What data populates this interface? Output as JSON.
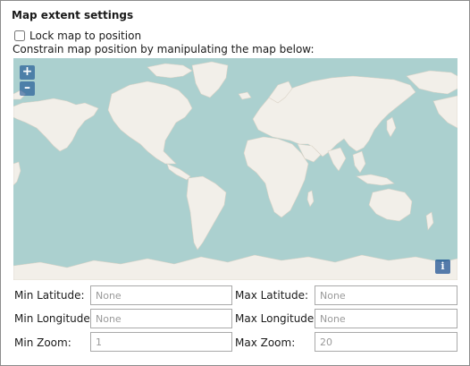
{
  "header": {
    "title": "Map extent settings"
  },
  "lock": {
    "label": "Lock map to position",
    "checked": false
  },
  "hint": "Constrain map position by manipulating the map below:",
  "map": {
    "zoom_in_label": "+",
    "zoom_out_label": "–",
    "info_label": "i",
    "ocean_color": "#abd0cf",
    "land_color": "#f2efe9"
  },
  "fields": {
    "min_latitude": {
      "label": "Min Latitude:",
      "placeholder": "None"
    },
    "max_latitude": {
      "label": "Max Latitude:",
      "placeholder": "None"
    },
    "min_longitude": {
      "label": "Min Longitude:",
      "placeholder": "None"
    },
    "max_longitude": {
      "label": "Max Longitude:",
      "placeholder": "None"
    },
    "min_zoom": {
      "label": "Min Zoom:",
      "placeholder": "1"
    },
    "max_zoom": {
      "label": "Max Zoom:",
      "placeholder": "20"
    }
  }
}
